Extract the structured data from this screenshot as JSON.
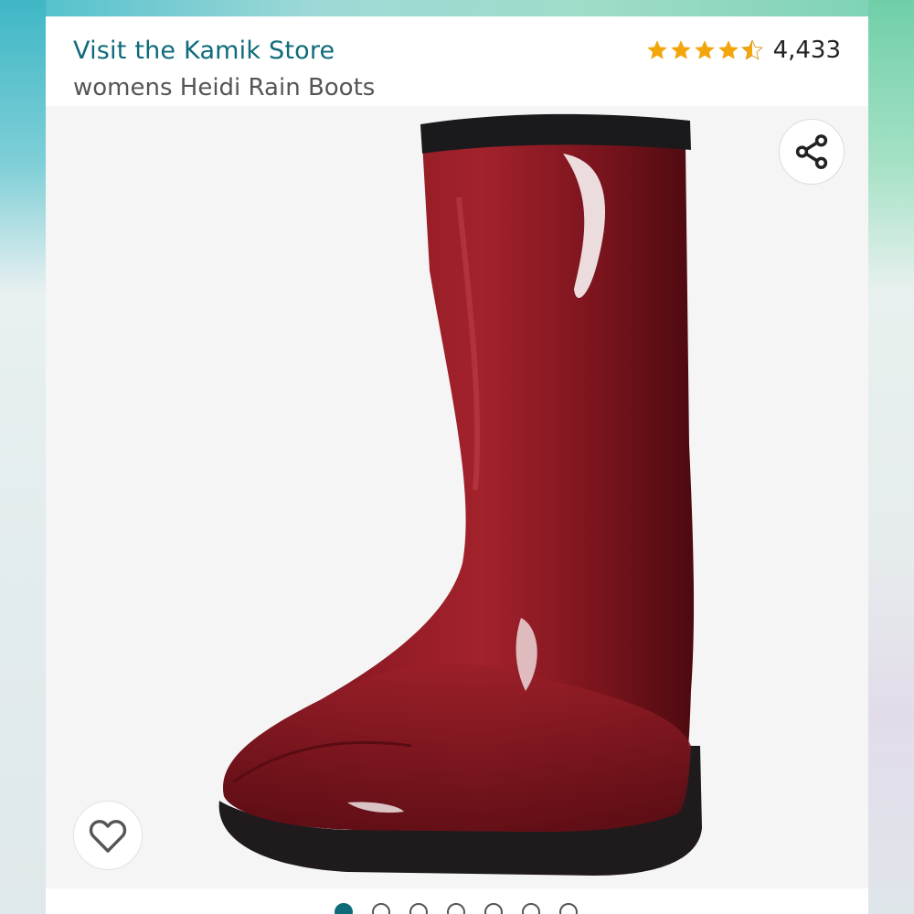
{
  "product": {
    "store_link": "Visit the Kamik Store",
    "title": "womens Heidi Rain Boots",
    "rating": {
      "stars": 4.5,
      "count": "4,433"
    }
  },
  "gallery": {
    "image_count": 7,
    "active_index": 0,
    "share_icon": "share-icon",
    "wishlist_icon": "heart-icon"
  },
  "colors": {
    "link": "#0f6b7a",
    "star": "#f2a60c",
    "boot": "#8b1a22"
  }
}
